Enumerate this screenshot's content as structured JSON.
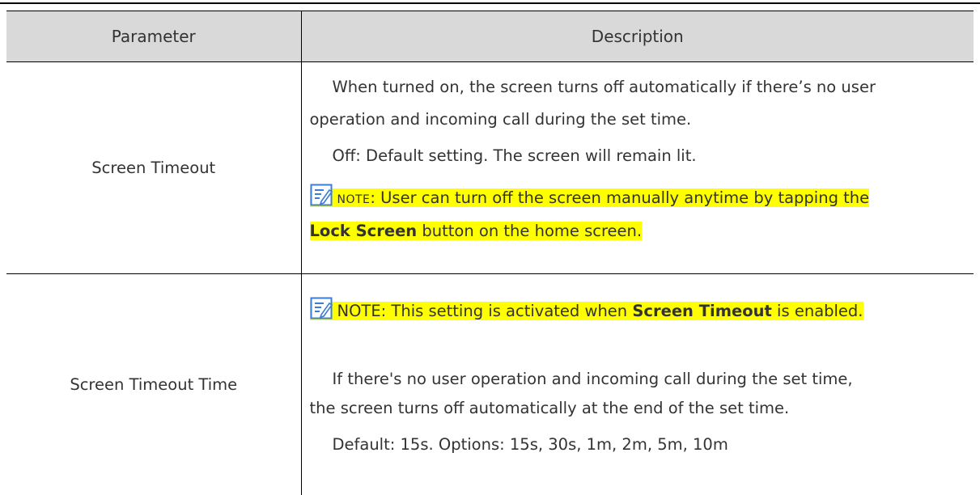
{
  "table": {
    "header": {
      "parameter": "Parameter",
      "description": "Description"
    },
    "rows": [
      {
        "parameter": "Screen Timeout",
        "desc_line1": "When turned on, the screen turns off automatically if there’s no user",
        "desc_line2": "operation and incoming call during the set time.",
        "desc_line3": "Off: Default setting. The screen will remain lit.",
        "note_label": "NOTE",
        "note_text1": ": User can turn off the screen manually anytime by tapping the",
        "note_bold": "Lock Screen",
        "note_text2": " button on the home screen."
      },
      {
        "parameter": "Screen Timeout Time",
        "note_prefix": "NOTE: This setting is activated when ",
        "note_bold": "Screen Timeout",
        "note_suffix": " is enabled.",
        "desc_line1": "If there's no user operation and incoming call during the set time,",
        "desc_line2": "the screen turns off automatically at the end of the set time.",
        "desc_line3": "Default: 15s. Options: 15s, 30s, 1m, 2m, 5m, 10m"
      }
    ]
  },
  "colors": {
    "highlight": "#ffff00",
    "header_bg": "#d9d9d9",
    "icon_blue": "#3b7dd8"
  },
  "icons": {
    "note": "note-pen-icon"
  }
}
